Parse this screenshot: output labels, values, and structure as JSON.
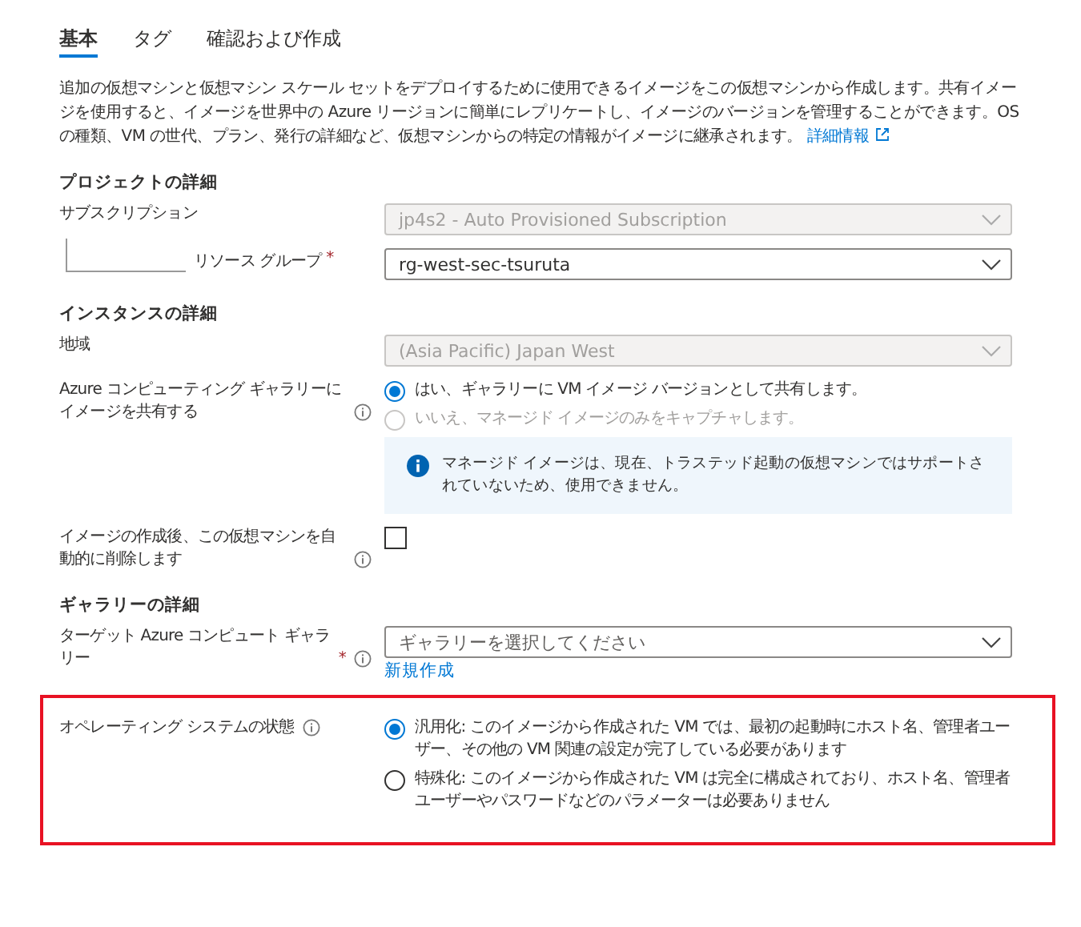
{
  "tabs": [
    {
      "label": "基本",
      "selected": true
    },
    {
      "label": "タグ",
      "selected": false
    },
    {
      "label": "確認および作成",
      "selected": false
    }
  ],
  "description": {
    "text": "追加の仮想マシンと仮想マシン スケール セットをデプロイするために使用できるイメージをこの仮想マシンから作成します。共有イメージを使用すると、イメージを世界中の Azure リージョンに簡単にレプリケートし、イメージのバージョンを管理することができます。OS の種類、VM の世代、プラン、発行の詳細など、仮想マシンからの特定の情報がイメージに継承されます。",
    "link": "詳細情報"
  },
  "sections": [
    {
      "title": "プロジェクトの詳細",
      "fields": [
        {
          "kind": "dropdown",
          "label": "サブスクリプション",
          "value": "jp4s2 - Auto Provisioned Subscription",
          "disabled": true
        },
        {
          "kind": "dropdown",
          "label": "リソース グループ",
          "required_mark": "*",
          "child": true,
          "value": "rg-west-sec-tsuruta",
          "disabled": false
        }
      ]
    },
    {
      "title": "インスタンスの詳細",
      "fields": [
        {
          "kind": "dropdown",
          "label": "地域",
          "value": "(Asia Pacific) Japan West",
          "disabled": true
        },
        {
          "kind": "radio_group",
          "label": "Azure コンピューティング ギャラリーにイメージを共有する",
          "info": true,
          "options": [
            {
              "text": "はい、ギャラリーに VM イメージ バージョンとして共有します。",
              "selected": true,
              "disabled": false
            },
            {
              "text": "いいえ、マネージド イメージのみをキャプチャします。",
              "selected": false,
              "disabled": true
            }
          ],
          "note": "マネージド イメージは、現在、トラステッド起動の仮想マシンではサポートされていないため、使用できません。"
        },
        {
          "kind": "checkbox",
          "label": "イメージの作成後、この仮想マシンを自動的に削除します",
          "info": true,
          "checked": false
        }
      ]
    },
    {
      "title": "ギャラリーの詳細",
      "fields": [
        {
          "kind": "dropdown",
          "label": "ターゲット Azure コンピュート ギャラリー",
          "required_mark": "*",
          "info": true,
          "placeholder": "ギャラリーを選択してください",
          "disabled": false,
          "link": "新規作成"
        },
        {
          "kind": "radio_group",
          "label": "オペレーティング システムの状態",
          "info": true,
          "highlighted": true,
          "options": [
            {
              "text": "汎用化: このイメージから作成された VM では、最初の起動時にホスト名、管理者ユーザー、その他の VM 関連の設定が完了している必要があります",
              "selected": true,
              "disabled": false
            },
            {
              "text": "特殊化: このイメージから作成された VM は完全に構成されており、ホスト名、管理者ユーザーやパスワードなどのパラメーターは必要ありません",
              "selected": false,
              "disabled": false
            }
          ]
        }
      ]
    }
  ]
}
